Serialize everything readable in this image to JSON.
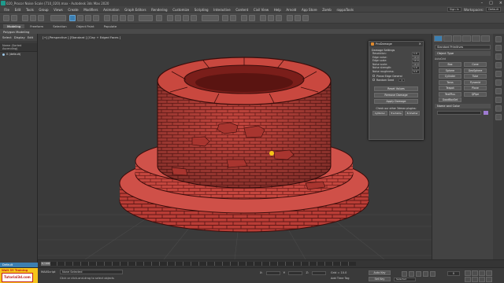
{
  "window": {
    "title": "020_Procor Noise Scale (710_020).max - Autodesk 3ds Max 2020"
  },
  "menu": {
    "items": [
      "File",
      "Edit",
      "Tools",
      "Group",
      "Views",
      "Create",
      "Modifiers",
      "Animation",
      "Graph Editors",
      "Rendering",
      "Customize",
      "Scripting",
      "Interactive",
      "Content",
      "Civil View",
      "Help",
      "Arnold",
      "App Store",
      "Zomb",
      "rappaTools"
    ],
    "signin": "Sign In",
    "workspace": "Workspaces:",
    "workspace_value": "Default"
  },
  "ribbon": {
    "tabs": [
      "Modeling",
      "Freeform",
      "Selection",
      "Object Paint",
      "Populate"
    ],
    "active": "Modeling",
    "sub": "Polygon Modeling"
  },
  "explorer": {
    "tabs": [
      "Select",
      "Display",
      "Edit"
    ],
    "header": "Name (Sorted Ascending)",
    "row": "0 (default)",
    "footer": "Default"
  },
  "viewport": {
    "label": "[+] [Perspective ] [Standard ] [Clay + Edged Faces ]"
  },
  "prodamage": {
    "title": "ProDamage",
    "section": "Damage Settings",
    "params": [
      {
        "label": "Resolution:",
        "value": "1.0"
      },
      {
        "label": "Edge noise:",
        "value": "10.0"
      },
      {
        "label": "Edge scale:",
        "value": "10.0"
      },
      {
        "label": "Noise scale:",
        "value": "10.0"
      },
      {
        "label": "Noise strength:",
        "value": "1.0"
      },
      {
        "label": "Noise roughness:",
        "value": "0.0"
      }
    ],
    "check1": "Planar Edge General",
    "check2": "Random Seed",
    "seed": "1",
    "buttons": [
      "Reset Values",
      "Remove Damage",
      "Apply Damage"
    ],
    "note": "Check our other 3dmax plugins:",
    "bottom": [
      "CyIRoller",
      "Tractable",
      "B-Shatter"
    ]
  },
  "cmdpanel": {
    "dropdown": "Standard Primitives",
    "rollout1": "Object Type",
    "autogrid": "AutoGrid",
    "primitives": [
      "Box",
      "Cone",
      "Sphere",
      "GeoSphere",
      "Cylinder",
      "Tube",
      "Torus",
      "Pyramid",
      "Teapot",
      "Plane",
      "TextPlus",
      "QPipe",
      "GoodBoxSet"
    ],
    "rollout2": "Name and Color"
  },
  "timeline": {
    "frame": "0 / 100"
  },
  "status": {
    "brand_line1": "Wait 3Y Training",
    "brand_line2": "Tutorial3d.com",
    "ms": "MAXScript",
    "message": "None Selected",
    "hint": "Click or click-and-drag to select objects",
    "x": "X:",
    "y": "Y:",
    "z": "Z:",
    "grid": "Grid = 10.0",
    "addtime": "Add Time Tag",
    "autokey": "Auto Key",
    "setkey": "Set Key",
    "filter": "Selected",
    "frame": "0"
  },
  "colors": {
    "object": "#c0443d",
    "accent": "#3c7fb1",
    "brand": "#f6c51b"
  }
}
